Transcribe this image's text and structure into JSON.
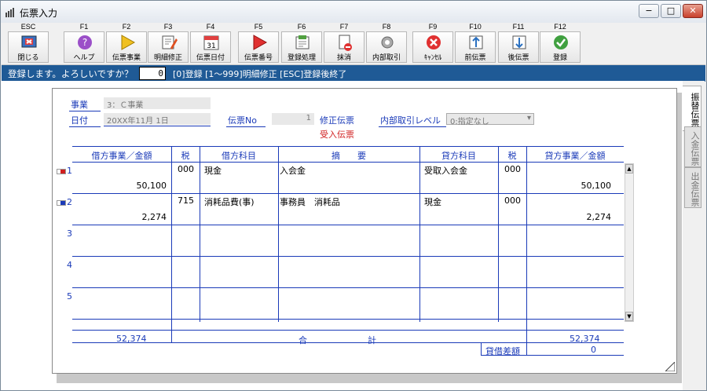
{
  "window": {
    "title": "伝票入力",
    "min": "−",
    "max": "□",
    "close": "✕"
  },
  "toolbar": [
    {
      "key": "ESC",
      "label": "閉じる",
      "icon": "close-window-icon"
    },
    {
      "key": "F1",
      "label": "ヘルプ",
      "icon": "help-icon"
    },
    {
      "key": "F2",
      "label": "伝票事業",
      "icon": "play-yellow-icon"
    },
    {
      "key": "F3",
      "label": "明細修正",
      "icon": "edit-icon"
    },
    {
      "key": "F4",
      "label": "伝票日付",
      "icon": "calendar-icon"
    },
    {
      "key": "F5",
      "label": "伝票番号",
      "icon": "play-red-icon"
    },
    {
      "key": "F6",
      "label": "登録処理",
      "icon": "register-icon"
    },
    {
      "key": "F7",
      "label": "抹消",
      "icon": "delete-doc-icon"
    },
    {
      "key": "F8",
      "label": "内部取引",
      "icon": "gear-icon"
    },
    {
      "key": "F9",
      "label": "ｷｬﾝｾﾙ",
      "icon": "cancel-icon"
    },
    {
      "key": "F10",
      "label": "前伝票",
      "icon": "prev-slip-icon"
    },
    {
      "key": "F11",
      "label": "後伝票",
      "icon": "next-slip-icon"
    },
    {
      "key": "F12",
      "label": "登録",
      "icon": "check-icon"
    }
  ],
  "prompt": {
    "question": "登録します。よろしいですか？",
    "value": "0",
    "help": "[0]登録  [1～999]明細修正  [ESC]登録後終了"
  },
  "form": {
    "jigyo_label": "事業",
    "jigyo_value": "3：Ｃ事業",
    "date_label": "日付",
    "date_value": "20XX年11月 1日",
    "slip_no_label": "伝票No",
    "slip_no_value": "1",
    "mode1": "修正伝票",
    "mode2": "受入伝票",
    "internal_label": "内部取引レベル",
    "internal_value": "0:指定なし"
  },
  "table": {
    "headers": [
      "借方事業／金額",
      "税",
      "借方科目",
      "摘　　要",
      "貸方科目",
      "税",
      "貸方事業／金額"
    ],
    "rows": [
      {
        "no": "1",
        "debit_amount": "50,100",
        "debit_tax": "000",
        "debit_account": "現金",
        "summary": "入会金",
        "credit_account": "受取入会金",
        "credit_tax": "000",
        "credit_amount": "50,100"
      },
      {
        "no": "2",
        "debit_amount": "2,274",
        "debit_tax": "715",
        "debit_account": "消耗品費(事)",
        "summary": "事務員　消耗品",
        "credit_account": "現金",
        "credit_tax": "000",
        "credit_amount": "2,274"
      },
      {
        "no": "3",
        "debit_amount": "",
        "debit_tax": "",
        "debit_account": "",
        "summary": "",
        "credit_account": "",
        "credit_tax": "",
        "credit_amount": ""
      },
      {
        "no": "4",
        "debit_amount": "",
        "debit_tax": "",
        "debit_account": "",
        "summary": "",
        "credit_account": "",
        "credit_tax": "",
        "credit_amount": ""
      },
      {
        "no": "5",
        "debit_amount": "",
        "debit_tax": "",
        "debit_account": "",
        "summary": "",
        "credit_account": "",
        "credit_tax": "",
        "credit_amount": ""
      }
    ]
  },
  "totals": {
    "debit_total": "52,374",
    "total_label": "合　　　　　　　計",
    "credit_total": "52,374",
    "diff_label": "貸借差額",
    "diff_value": "0"
  },
  "side_tabs": [
    "振替伝票",
    "入金伝票",
    "出金伝票"
  ]
}
